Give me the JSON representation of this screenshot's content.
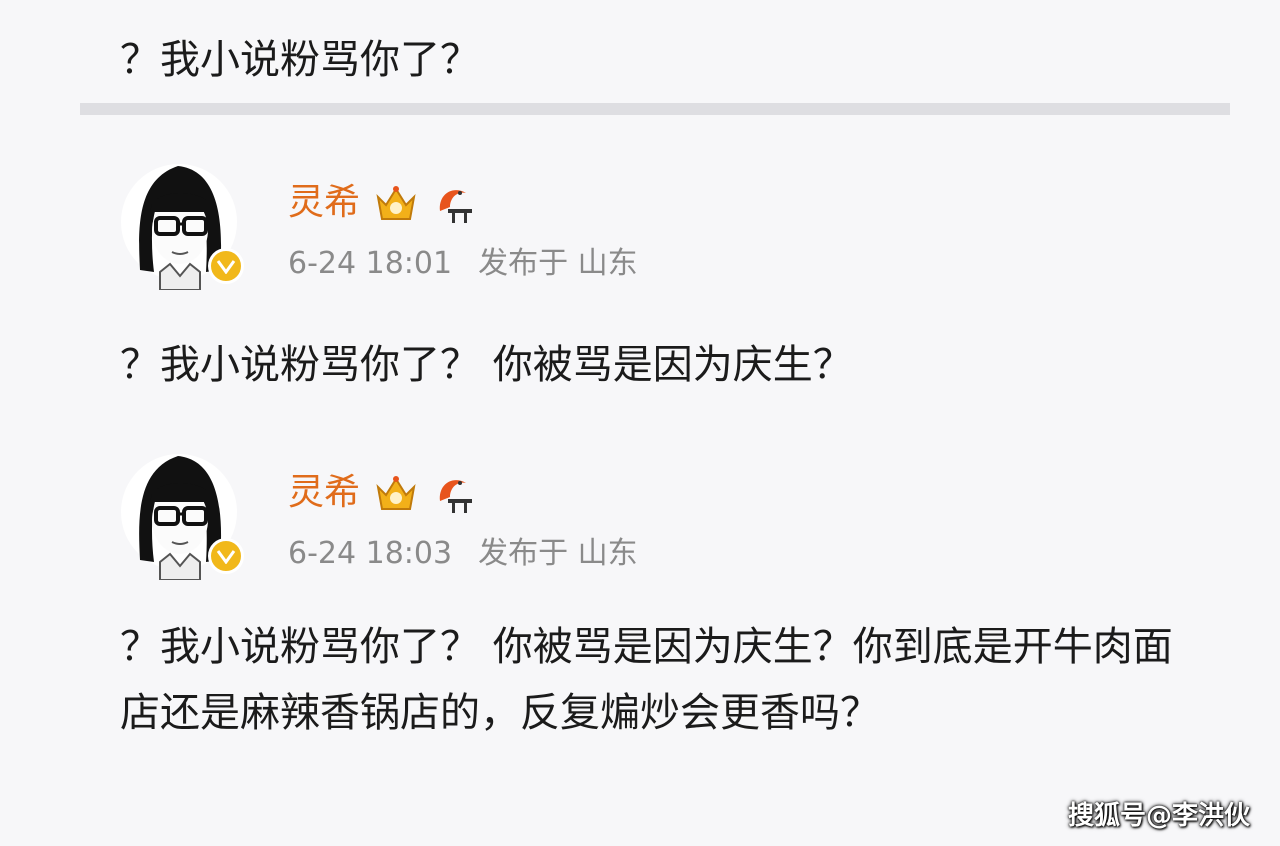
{
  "top_comment": {
    "text": "？我小说粉骂你了？"
  },
  "posts": [
    {
      "username": "灵希",
      "time": "6-24 18:01",
      "location": "发布于 山东",
      "text": "？我小说粉骂你了？ 你被骂是因为庆生？"
    },
    {
      "username": "灵希",
      "time": "6-24 18:03",
      "location": "发布于 山东",
      "text": "？我小说粉骂你了？ 你被骂是因为庆生？你到底是开牛肉面店还是麻辣香锅店的，反复煸炒会更香吗？"
    }
  ],
  "icons": {
    "crown_badge": "crown-badge-icon",
    "shrimp_badge": "shrimp-badge-icon",
    "verified": "verified-icon"
  },
  "colors": {
    "username": "#e06c1b",
    "meta": "#8a8a8a",
    "verified": "#f1b81a"
  },
  "watermark": {
    "text": "搜狐号@李洪伙"
  }
}
